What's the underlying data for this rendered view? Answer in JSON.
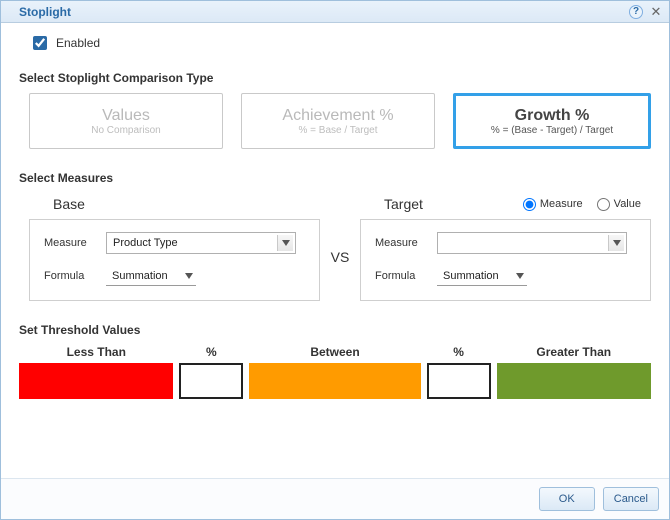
{
  "window": {
    "title": "Stoplight"
  },
  "enabled": {
    "label": "Enabled",
    "checked": true
  },
  "comparison": {
    "heading": "Select Stoplight Comparison Type",
    "options": [
      {
        "title": "Values",
        "sub": "No Comparison",
        "selected": false
      },
      {
        "title": "Achievement %",
        "sub": "% = Base / Target",
        "selected": false
      },
      {
        "title": "Growth %",
        "sub": "% = (Base - Target) / Target",
        "selected": true
      }
    ]
  },
  "measures": {
    "heading": "Select Measures",
    "vs": "VS",
    "base": {
      "title": "Base",
      "measure_label": "Measure",
      "measure_value": "Product Type",
      "formula_label": "Formula",
      "formula_value": "Summation"
    },
    "target": {
      "title": "Target",
      "radio_measure": "Measure",
      "radio_value": "Value",
      "radio_selected": "Measure",
      "measure_label": "Measure",
      "measure_value": "",
      "formula_label": "Formula",
      "formula_value": "Summation"
    }
  },
  "threshold": {
    "heading": "Set Threshold Values",
    "less_label": "Less Than",
    "pct_label": "%",
    "between_label": "Between",
    "greater_label": "Greater Than",
    "low_value": "",
    "high_value": "",
    "colors": {
      "low": "#ff0000",
      "mid": "#ff9b00",
      "high": "#6f9a2c"
    }
  },
  "buttons": {
    "ok": "OK",
    "cancel": "Cancel"
  }
}
